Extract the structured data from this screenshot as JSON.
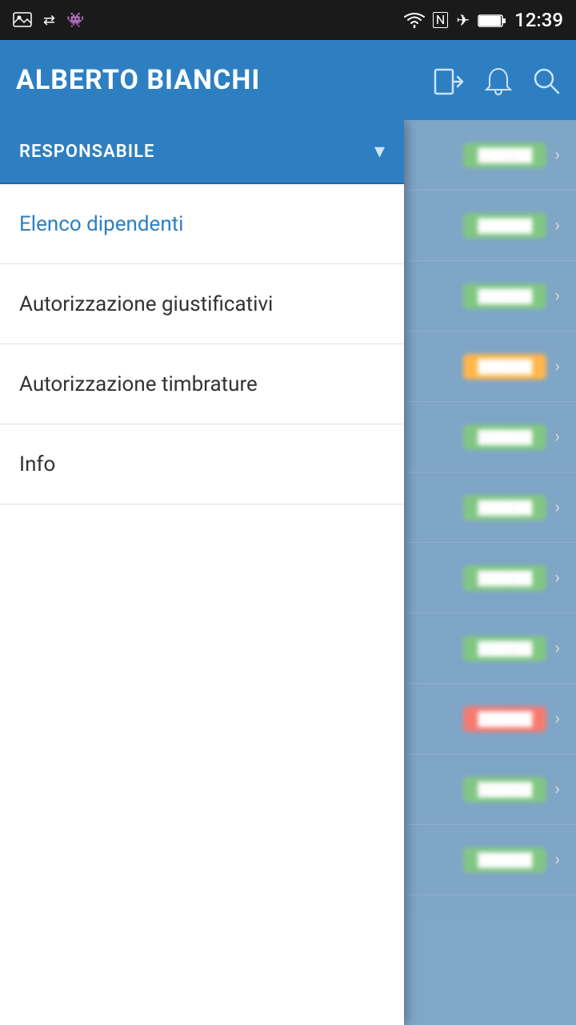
{
  "statusBar": {
    "time": "12:39"
  },
  "toolbar": {
    "title": "ALBERTO BIANCHI",
    "logoutIcon": "logout-icon",
    "bellIcon": "bell-icon",
    "searchIcon": "search-icon"
  },
  "drawerHeader": {
    "title": "RESPONSABILE",
    "chevronIcon": "chevron-down-icon"
  },
  "menuItems": [
    {
      "label": "Elenco dipendenti",
      "active": true
    },
    {
      "label": "Autorizzazione giustificativi",
      "active": false
    },
    {
      "label": "Autorizzazione timbrature",
      "active": false
    },
    {
      "label": "Info",
      "active": false
    }
  ],
  "backgroundRows": [
    {
      "badgeColor": "green"
    },
    {
      "badgeColor": "green"
    },
    {
      "badgeColor": "green"
    },
    {
      "badgeColor": "orange"
    },
    {
      "badgeColor": "green"
    },
    {
      "badgeColor": "green"
    },
    {
      "badgeColor": "green"
    },
    {
      "badgeColor": "green"
    },
    {
      "badgeColor": "red"
    },
    {
      "badgeColor": "green"
    },
    {
      "badgeColor": "green"
    }
  ],
  "colors": {
    "toolbarBg": "#2e7fc1",
    "activeMenu": "#2e7fc1",
    "menuText": "#333333"
  }
}
